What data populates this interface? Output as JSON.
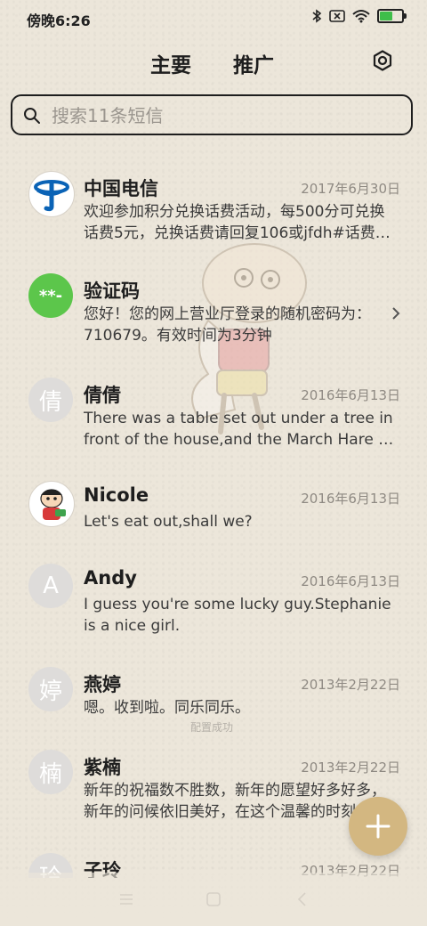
{
  "status": {
    "time": "傍晚6:26"
  },
  "tabs": {
    "main": "主要",
    "promo": "推广"
  },
  "search": {
    "placeholder": "搜索11条短信"
  },
  "messages": [
    {
      "sender": "中国电信",
      "date": "2017年6月30日",
      "preview": "欢迎参加积分兑换话费活动，每500分可兑换话费5元，兑换话费请回复106或jfdh#话费…",
      "avatar_icon": "china-telecom-logo"
    },
    {
      "sender": "验证码",
      "date": "",
      "preview": "您好！您的网上营业厅登录的随机密码为：710679。有效时间为3分钟",
      "avatar_text": "**-",
      "avatar_color": "#5cc64b"
    },
    {
      "sender": "倩倩",
      "date": "2016年6月13日",
      "preview": "There was a table set out under a tree in front of the house,and the March Hare …",
      "avatar_text": "倩"
    },
    {
      "sender": "Nicole",
      "date": "2016年6月13日",
      "preview": "Let's eat out,shall we?",
      "avatar_icon": "cartoon-avatar"
    },
    {
      "sender": "Andy",
      "date": "2016年6月13日",
      "preview": "I guess you're some lucky guy.Stephanie is a nice girl.",
      "avatar_text": "A"
    },
    {
      "sender": "燕婷",
      "date": "2013年2月22日",
      "preview": "嗯。收到啦。同乐同乐。",
      "avatar_text": "婷"
    },
    {
      "sender": "紫楠",
      "date": "2013年2月22日",
      "preview": "新年的祝福数不胜数，新年的愿望好多好多，新年的问候依旧美好，在这个温馨的时刻…",
      "avatar_text": "楠"
    },
    {
      "sender": "子玲",
      "date": "2013年2月22日",
      "preview": "",
      "avatar_text": "玲"
    }
  ],
  "toast": "配置成功",
  "colors": {
    "background": "#ece6da",
    "fab": "#d3b781",
    "verify_avatar": "#5cc64b",
    "telecom_blue": "#0a63b6"
  }
}
